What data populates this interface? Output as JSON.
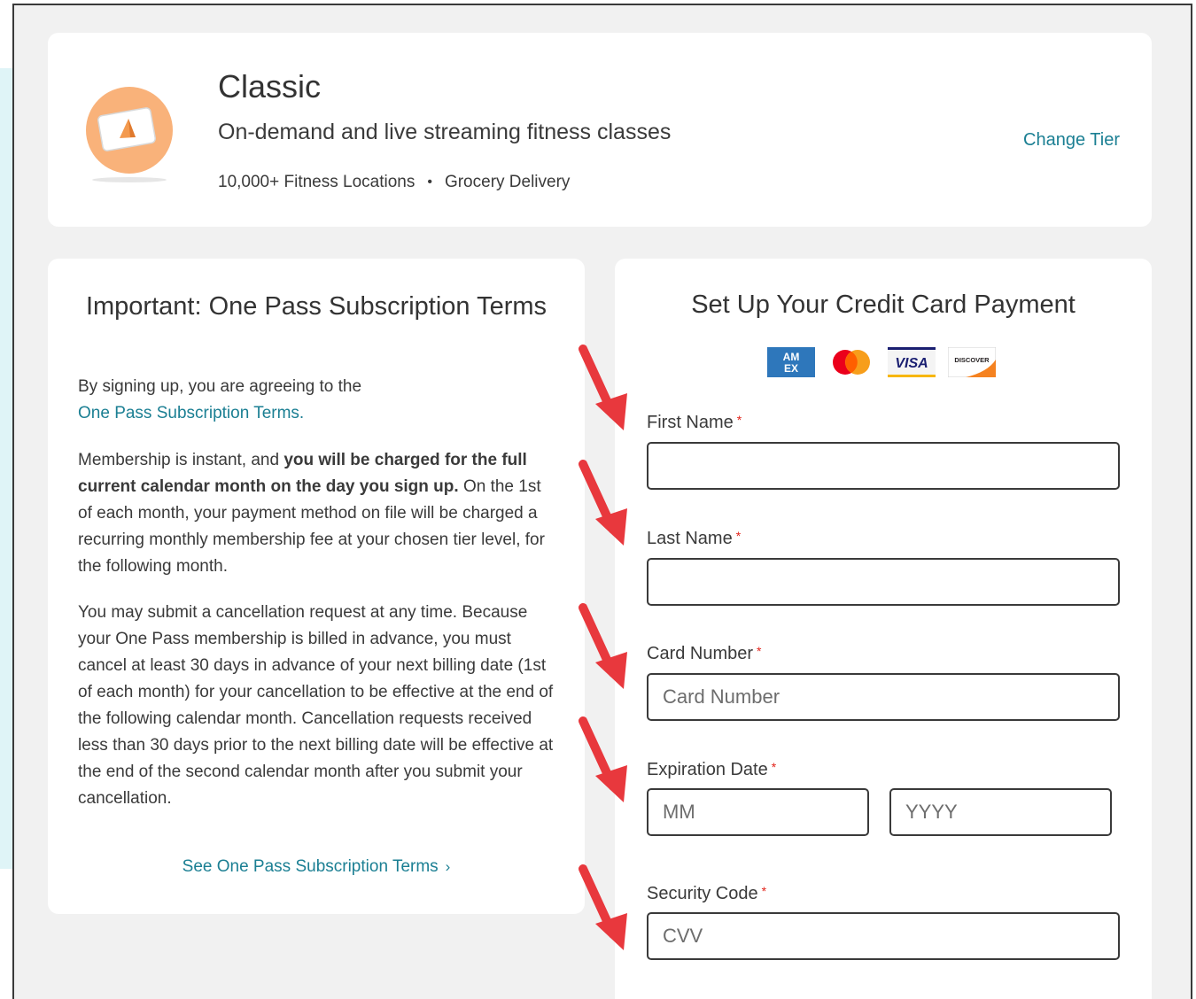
{
  "tier": {
    "title": "Classic",
    "subtitle": "On-demand and live streaming fitness classes",
    "features": [
      "10,000+ Fitness Locations",
      "Grocery Delivery"
    ],
    "separator": "•",
    "change_label": "Change Tier"
  },
  "terms": {
    "title": "Important: One Pass Subscription Terms",
    "p1_text": "By signing up, you are agreeing to the",
    "p1_link": "One Pass Subscription Terms.",
    "p2_plain1": "Membership is instant, and ",
    "p2_bold": "you will be charged for the full current calendar month on the day you sign up.",
    "p2_plain2": " On the 1st of each month, your payment method on file will be charged a recurring monthly membership fee at your chosen tier level, for the following month.",
    "p3": "You may submit a cancellation request at any time. Because your One Pass membership is billed in advance, you must cancel at least 30 days in advance of your next billing date (1st of each month) for your cancellation to be effective at the end of the following calendar month. Cancellation requests received less than 30 days prior to the next billing date will be effective at the end of the second calendar month after you submit your cancellation.",
    "see_terms_label": "See One Pass Subscription Terms",
    "see_terms_chevron": "›"
  },
  "payment": {
    "title": "Set Up Your Credit Card Payment",
    "card_logos": {
      "amex": "AM EX",
      "visa": "VISA",
      "discover": "DISCOVER"
    },
    "required_mark": "*",
    "first_name": {
      "label": "First Name",
      "value": "",
      "placeholder": ""
    },
    "last_name": {
      "label": "Last Name",
      "value": "",
      "placeholder": ""
    },
    "card_number": {
      "label": "Card Number",
      "value": "",
      "placeholder": "Card Number"
    },
    "expiration": {
      "label": "Expiration Date",
      "month_placeholder": "MM",
      "year_placeholder": "YYYY"
    },
    "security_code": {
      "label": "Security Code",
      "value": "",
      "placeholder": "CVV"
    }
  },
  "colors": {
    "link": "#1b7f93",
    "required": "#e2231a",
    "annotation_arrow": "#e8383d",
    "tier_icon": "#f9b27a"
  }
}
